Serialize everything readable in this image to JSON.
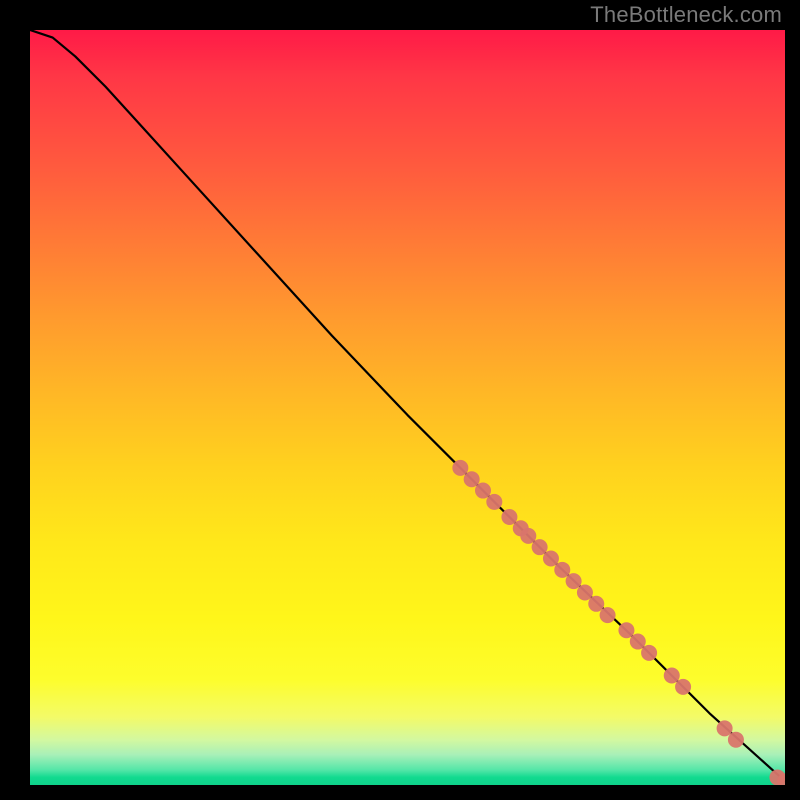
{
  "attribution": "TheBottleneck.com",
  "colors": {
    "dot": "#d9756c",
    "line": "#000000",
    "background_top": "#ff1a47",
    "background_bottom": "#0fd18a"
  },
  "chart_data": {
    "type": "line",
    "title": "",
    "xlabel": "",
    "ylabel": "",
    "xlim": [
      0,
      100
    ],
    "ylim": [
      0,
      100
    ],
    "grid": false,
    "legend": false,
    "series": [
      {
        "name": "curve",
        "kind": "line",
        "x": [
          0,
          3,
          6,
          10,
          15,
          20,
          30,
          40,
          50,
          60,
          70,
          80,
          90,
          100
        ],
        "y": [
          100,
          99,
          96.5,
          92.5,
          87,
          81.5,
          70.5,
          59.5,
          49,
          39,
          29,
          19.5,
          9.5,
          0.5
        ]
      },
      {
        "name": "points",
        "kind": "scatter",
        "x": [
          57,
          58.5,
          60,
          61.5,
          63.5,
          65,
          66,
          67.5,
          69,
          70.5,
          72,
          73.5,
          75,
          76.5,
          79,
          80.5,
          82,
          85,
          86.5,
          92,
          93.5,
          99,
          100
        ],
        "y": [
          42,
          40.5,
          39,
          37.5,
          35.5,
          34,
          33,
          31.5,
          30,
          28.5,
          27,
          25.5,
          24,
          22.5,
          20.5,
          19,
          17.5,
          14.5,
          13,
          7.5,
          6,
          1,
          0.5
        ],
        "marker_radius": 8
      }
    ]
  }
}
